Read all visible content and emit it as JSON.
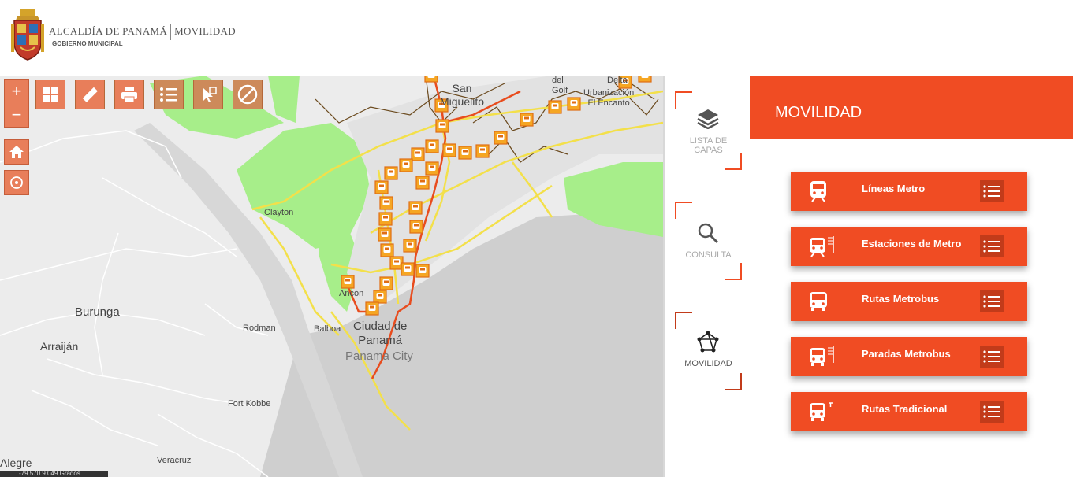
{
  "header": {
    "brand_name": "ALCALDÍA DE PANAMÁ",
    "brand_section": "MOVILIDAD",
    "brand_sub": "GOBIERNO MUNICIPAL"
  },
  "map": {
    "zoom_in": "+",
    "zoom_out": "−",
    "coordinates": "-79.570 9.049 Grados",
    "labels": {
      "san_miguelito": "San\nMiguelito",
      "del_golf": "del\nGolf",
      "delta": "Delta",
      "urbanizacion": "Urbanización\nEl Encanto",
      "clayton": "Clayton",
      "ancon": "Ancón",
      "burunga": "Burunga",
      "rodman": "Rodman",
      "balboa": "Balboa",
      "ciudad": "Ciudad de\nPanamá",
      "panama_city": "Panama City",
      "arraijan": "Arraiján",
      "fort_kobbe": "Fort Kobbe",
      "veracruz": "Veracruz",
      "alegre": "Alegre"
    }
  },
  "nav": {
    "items": [
      {
        "label": "LISTA DE\nCAPAS",
        "icon": "layers-icon"
      },
      {
        "label": "CONSULTA",
        "icon": "search-icon"
      },
      {
        "label": "MOVILIDAD",
        "icon": "network-icon"
      }
    ]
  },
  "panel": {
    "title": "MOVILIDAD",
    "items": [
      {
        "label": "Líneas Metro",
        "icon": "metro-icon"
      },
      {
        "label": "Estaciones de Metro",
        "icon": "metro-station-icon"
      },
      {
        "label": "Rutas Metrobus",
        "icon": "bus-icon"
      },
      {
        "label": "Paradas Metrobus",
        "icon": "bus-stop-icon"
      },
      {
        "label": "Rutas Tradicional",
        "icon": "traditional-bus-icon"
      }
    ]
  },
  "colors": {
    "accent": "#f04c23",
    "tool": "#cd8a5a",
    "water": "#cfcfcf",
    "land": "#ececec",
    "park": "#a7ee8a",
    "road_primary": "#f3e04a",
    "metro_line": "#e84c1e"
  }
}
